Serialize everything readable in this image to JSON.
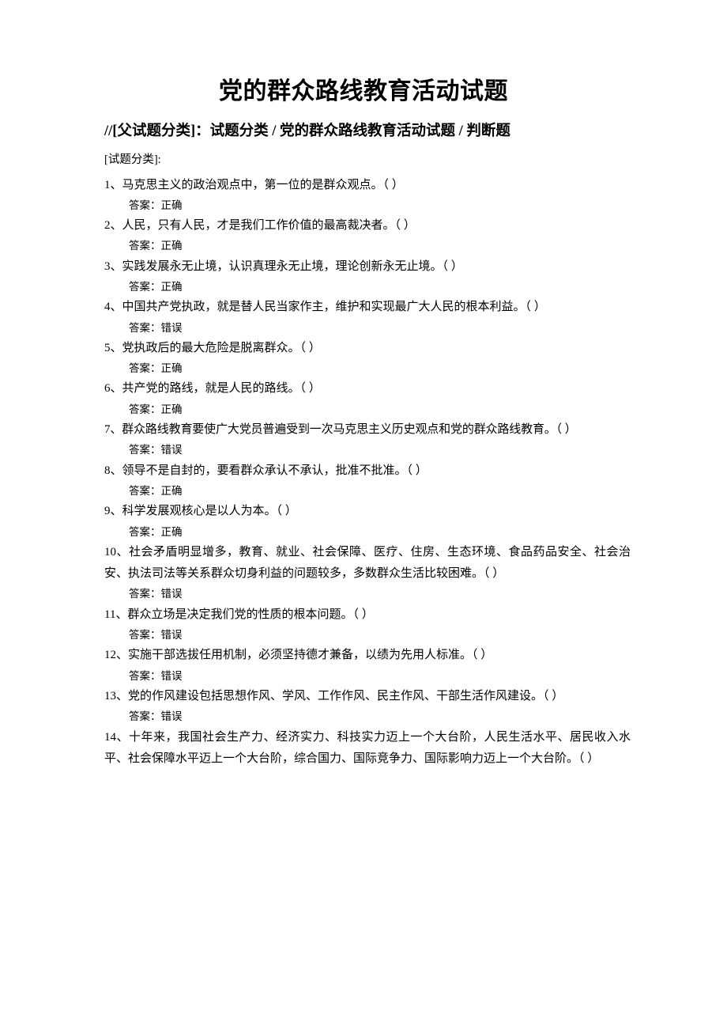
{
  "document": {
    "title": "党的群众路线教育活动试题",
    "breadcrumb": "//[父试题分类]：试题分类 / 党的群众路线教育活动试题 / 判断题",
    "category_label": "[试题分类]:",
    "answer_prefix": "答案：",
    "items": [
      {
        "number": "1、",
        "text": "马克思主义的政治观点中，第一位的是群众观点。（    ）",
        "answer": "答案：正确"
      },
      {
        "number": "2、",
        "text": "人民，只有人民，才是我们工作价值的最高裁决者。（  ）",
        "answer": "答案：正确"
      },
      {
        "number": "3、",
        "text": "实践发展永无止境，认识真理永无止境，理论创新永无止境。（    ）",
        "answer": "答案：正确"
      },
      {
        "number": "4、",
        "text": "中国共产党执政，就是替人民当家作主，维护和实现最广大人民的根本利益。（  ）",
        "answer": "答案：错误"
      },
      {
        "number": "5、",
        "text": "党执政后的最大危险是脱离群众。（  ）",
        "answer": "答案：正确"
      },
      {
        "number": "6、",
        "text": "共产党的路线，就是人民的路线。（  ）",
        "answer": "答案：正确"
      },
      {
        "number": "7、",
        "text": "群众路线教育要使广大党员普遍受到一次马克思主义历史观点和党的群众路线教育。（    ）",
        "answer": "答案：错误"
      },
      {
        "number": "8、",
        "text": "领导不是自封的，要看群众承认不承认，批准不批准。（  ）",
        "answer": "答案：正确"
      },
      {
        "number": "9、",
        "text": "科学发展观核心是以人为本。（    ）",
        "answer": "答案：正确"
      },
      {
        "number": "10、",
        "text": "社会矛盾明显增多，教育、就业、社会保障、医疗、住房、生态环境、食品药品安全、社会治安、执法司法等关系群众切身利益的问题较多，多数群众生活比较困难。（    ）",
        "answer": "答案：错误"
      },
      {
        "number": "11、",
        "text": "群众立场是决定我们党的性质的根本问题。（    ）",
        "answer": "答案：错误"
      },
      {
        "number": "12、",
        "text": "实施干部选拔任用机制，必须坚持德才兼备，以绩为先用人标准。（    ）",
        "answer": "答案：错误"
      },
      {
        "number": "13、",
        "text": "党的作风建设包括思想作风、学风、工作作风、民主作风、干部生活作风建设。（    ）",
        "answer": "答案：错误"
      },
      {
        "number": "14、",
        "text": "十年来，我国社会生产力、经济实力、科技实力迈上一个大台阶，人民生活水平、居民收入水平、社会保障水平迈上一个大台阶，综合国力、国际竞争力、国际影响力迈上一个大台阶。（    ）",
        "answer": ""
      }
    ]
  }
}
